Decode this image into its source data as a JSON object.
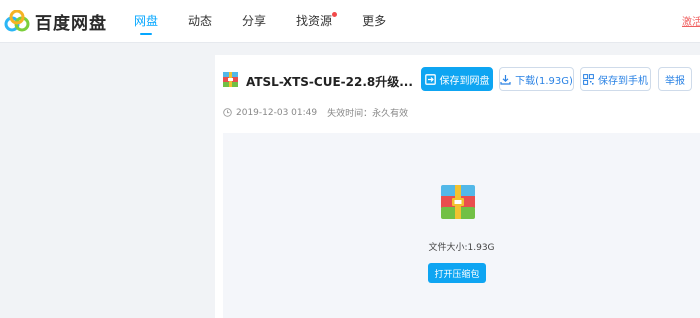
{
  "brand": {
    "name": "百度网盘"
  },
  "nav": {
    "items": [
      {
        "label": "网盘",
        "active": true
      },
      {
        "label": "动态",
        "active": false
      },
      {
        "label": "分享",
        "active": false
      },
      {
        "label": "找资源",
        "active": false,
        "badge": true
      },
      {
        "label": "更多",
        "active": false
      }
    ],
    "right_link": "激活"
  },
  "file": {
    "title": "ATSL-XTS-CUE-22.8升级...",
    "icon": "archive-icon",
    "created": "2019-12-03 01:49",
    "expiry": "失效时间：永久有效",
    "size_text": "文件大小:1.93G"
  },
  "actions": {
    "save_to_disk": "保存到网盘",
    "download": "下载(1.93G)",
    "save_to_phone": "保存到手机",
    "report": "举报",
    "open_archive": "打开压缩包"
  },
  "colors": {
    "accent": "#06a7ff",
    "primary_button": "#0ea5f2",
    "badge": "#f24a4a"
  }
}
